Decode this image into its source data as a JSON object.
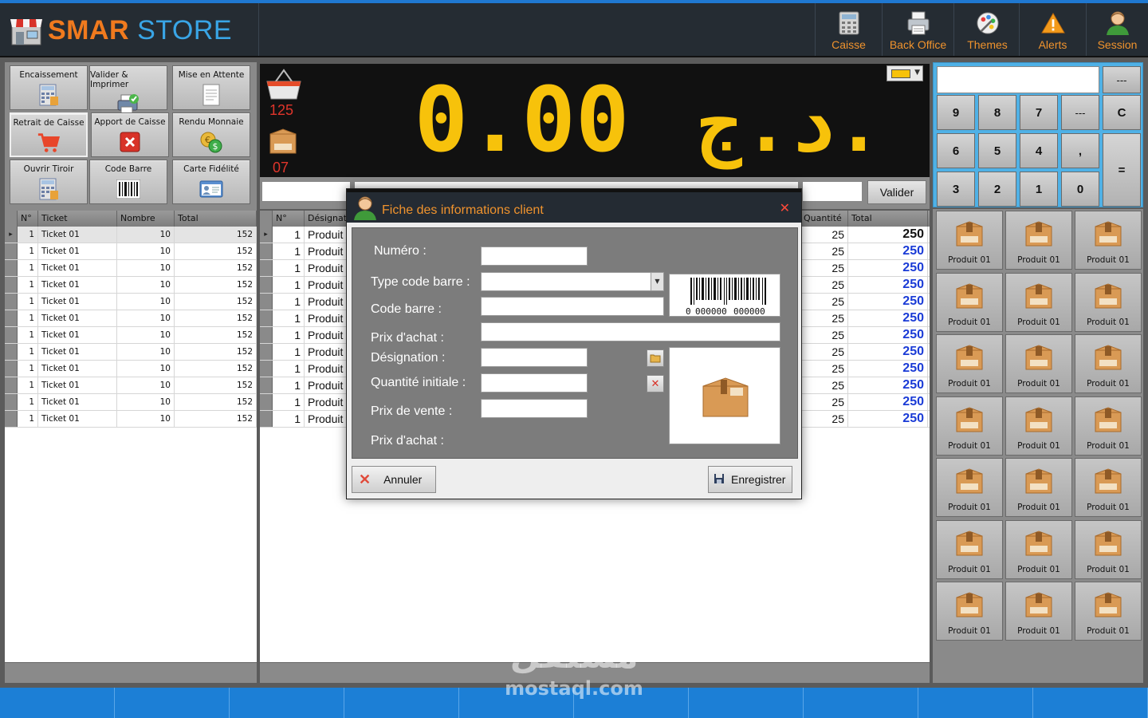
{
  "app": {
    "brand_part1": "SMAR",
    "brand_part2": "STORE"
  },
  "header": {
    "buttons": [
      {
        "label": "Caisse",
        "icon": "calculator-icon"
      },
      {
        "label": "Back Office",
        "icon": "printer-icon"
      },
      {
        "label": "Themes",
        "icon": "palette-icon"
      },
      {
        "label": "Alerts",
        "icon": "warning-icon"
      },
      {
        "label": "Session",
        "icon": "user-icon"
      }
    ]
  },
  "functions": [
    {
      "label": "Encaissement",
      "icon": "calculator-icon"
    },
    {
      "label": "Valider & Imprimer",
      "icon": "printer-check-icon"
    },
    {
      "label": "Mise en Attente",
      "icon": "document-icon"
    },
    {
      "label": "Retrait de Caisse",
      "icon": "cart-icon"
    },
    {
      "label": "Apport de Caisse",
      "icon": "close-icon"
    },
    {
      "label": "Rendu Monnaie",
      "icon": "coins-icon"
    },
    {
      "label": "Ouvrir Tiroir",
      "icon": "calculator-icon"
    },
    {
      "label": "Code Barre",
      "icon": "barcode-icon"
    },
    {
      "label": "Carte Fidélité",
      "icon": "id-card-icon"
    }
  ],
  "tickets": {
    "columns": [
      "N°",
      "Ticket",
      "Nombre",
      "Total"
    ],
    "rows": [
      [
        "1",
        "Ticket 01",
        "10",
        "152"
      ],
      [
        "1",
        "Ticket 01",
        "10",
        "152"
      ],
      [
        "1",
        "Ticket 01",
        "10",
        "152"
      ],
      [
        "1",
        "Ticket 01",
        "10",
        "152"
      ],
      [
        "1",
        "Ticket 01",
        "10",
        "152"
      ],
      [
        "1",
        "Ticket 01",
        "10",
        "152"
      ],
      [
        "1",
        "Ticket 01",
        "10",
        "152"
      ],
      [
        "1",
        "Ticket 01",
        "10",
        "152"
      ],
      [
        "1",
        "Ticket 01",
        "10",
        "152"
      ],
      [
        "1",
        "Ticket 01",
        "10",
        "152"
      ],
      [
        "1",
        "Ticket 01",
        "10",
        "152"
      ],
      [
        "1",
        "Ticket 01",
        "10",
        "152"
      ]
    ]
  },
  "display": {
    "basket_count": "125",
    "box_count": "07",
    "amount": "0.00",
    "currency": "د.ج."
  },
  "entry": {
    "validate_label": "Valider"
  },
  "items": {
    "columns": [
      "N°",
      "Désignation",
      "Quantité",
      "Total"
    ],
    "rows": [
      [
        "1",
        "Produit",
        "25",
        "250"
      ],
      [
        "1",
        "Produit",
        "25",
        "250"
      ],
      [
        "1",
        "Produit",
        "25",
        "250"
      ],
      [
        "1",
        "Produit",
        "25",
        "250"
      ],
      [
        "1",
        "Produit",
        "25",
        "250"
      ],
      [
        "1",
        "Produit",
        "25",
        "250"
      ],
      [
        "1",
        "Produit",
        "25",
        "250"
      ],
      [
        "1",
        "Produit",
        "25",
        "250"
      ],
      [
        "1",
        "Produit",
        "25",
        "250"
      ],
      [
        "1",
        "Produit",
        "25",
        "250"
      ],
      [
        "1",
        "Produit",
        "25",
        "250"
      ],
      [
        "1",
        "Produit",
        "25",
        "250"
      ]
    ]
  },
  "keypad": {
    "display_value": "",
    "side_label": "---",
    "keys": [
      "9",
      "8",
      "7",
      "---",
      "C",
      "6",
      "5",
      "4",
      ",",
      "3",
      "2",
      "1",
      "0"
    ],
    "equals": "="
  },
  "products": {
    "label": "Produit 01",
    "count": 21
  },
  "dialog": {
    "title": "Fiche des informations client",
    "close": "✕",
    "labels": {
      "numero": "Numéro :",
      "type_code": "Type code barre :",
      "code_barre": "Code barre :",
      "prix_achat": "Prix d'achat :",
      "designation": "Désignation :",
      "quantite": "Quantité initiale :",
      "prix_vente": "Prix de vente :",
      "prix_achat2": "Prix d'achat :"
    },
    "barcode_digits": {
      "left": "0",
      "mid": "000000",
      "right": "000000"
    },
    "cancel_label": "Annuler",
    "save_label": "Enregistrer"
  },
  "watermark": {
    "arabic": "مستقل",
    "latin": "mostaql.com"
  },
  "colors": {
    "accent_orange": "#f0932d",
    "digits_yellow": "#f7c20b",
    "footer_blue": "#1c7fd6",
    "total_blue": "#1a3bd6"
  }
}
